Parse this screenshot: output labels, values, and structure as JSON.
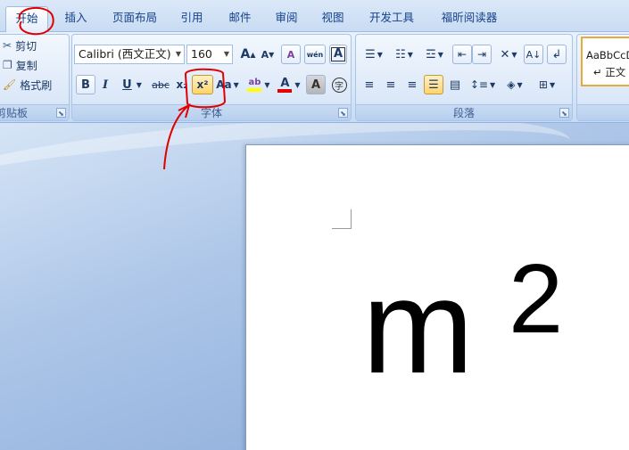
{
  "tabs": [
    "开始",
    "插入",
    "页面布局",
    "引用",
    "邮件",
    "审阅",
    "视图",
    "开发工具",
    "福昕阅读器"
  ],
  "clipboard": {
    "cut": "剪切",
    "copy": "复制",
    "format_painter": "格式刷",
    "label": "剪贴板"
  },
  "font": {
    "name": "Calibri (西文正文)",
    "size": "160",
    "label": "字体",
    "glyphs": {
      "grow": "A",
      "shrink": "A",
      "clear": "A",
      "phonetic": "wén",
      "border": "A",
      "bold": "B",
      "italic": "I",
      "underline": "U",
      "strike": "abc",
      "subscript": "x₂",
      "superscript": "x²",
      "case": "Aa",
      "highlight": "ab",
      "color": "A",
      "shade": "A",
      "enclose": "字"
    }
  },
  "paragraph": {
    "label": "段落"
  },
  "styles": {
    "preview": "AaBbCcD",
    "normal": "↵ 正文"
  },
  "document": {
    "base": "m",
    "exponent": "2"
  },
  "colors": {
    "annotation": "#e00000",
    "highlight_fill": "#ffd46a",
    "font_color_bar": "#e00000",
    "highlight_bar": "#ffff00"
  }
}
